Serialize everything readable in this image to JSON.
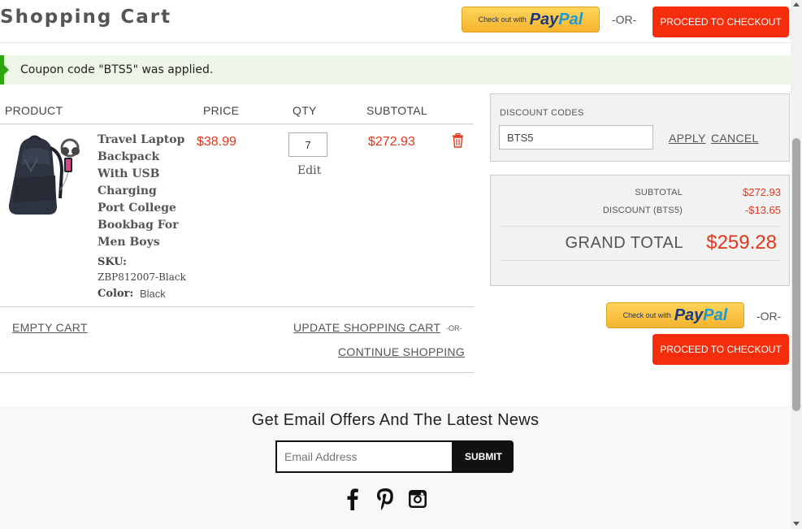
{
  "page": {
    "title": "Shopping Cart"
  },
  "header": {
    "paypal": {
      "prefix": "Check out with",
      "pay": "Pay",
      "pal": "Pal"
    },
    "or": "-OR-",
    "checkout_label": "PROCEED TO CHECKOUT"
  },
  "message": {
    "text": "Coupon code \"BTS5\" was applied."
  },
  "table": {
    "headers": {
      "product": "PRODUCT",
      "price": "PRICE",
      "qty": "QTY",
      "subtotal": "SUBTOTAL"
    }
  },
  "item": {
    "name": "Travel Laptop Backpack With USB Charging Port College Bookbag For Men Boys",
    "sku_label": "SKU:",
    "sku": "ZBP812007-Black",
    "color_label": "Color:",
    "color": "Black",
    "price": "$38.99",
    "qty": "7",
    "edit_label": "Edit",
    "subtotal": "$272.93",
    "image_icon": "backpack-image",
    "delete_icon": "trash-icon"
  },
  "actions": {
    "empty_cart": "EMPTY CART",
    "update_cart": "UPDATE SHOPPING CART",
    "or": "-OR-",
    "continue_shopping": "CONTINUE SHOPPING"
  },
  "discount": {
    "title": "DISCOUNT CODES",
    "code_value": "BTS5",
    "apply": "APPLY",
    "cancel": "CANCEL"
  },
  "totals": {
    "subtotal_label": "SUBTOTAL",
    "subtotal": "$272.93",
    "discount_label": "DISCOUNT (BTS5)",
    "discount": "-$13.65",
    "grand_total_label": "GRAND TOTAL",
    "grand_total": "$259.28"
  },
  "bottom_checkout": {
    "paypal": {
      "prefix": "Check out with",
      "pay": "Pay",
      "pal": "Pal"
    },
    "or": "-OR-",
    "checkout_label": "PROCEED TO CHECKOUT"
  },
  "newsletter": {
    "title": "Get Email Offers And The Latest News",
    "placeholder": "Email Address",
    "submit": "SUBMIT",
    "social": [
      "facebook-icon",
      "pinterest-icon",
      "instagram-icon"
    ]
  },
  "colors": {
    "accent": "#f42e0c",
    "price": "#e2371a",
    "success": "#2fa50f",
    "paypal_yellow": "#ffc439"
  }
}
